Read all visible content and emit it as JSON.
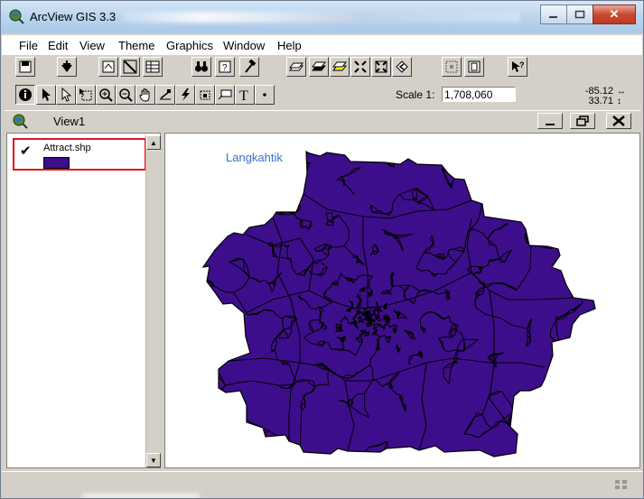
{
  "window": {
    "title": "ArcView GIS 3.3",
    "colors": {
      "titlebar": "#bcd6ef",
      "close": "#c74a33",
      "face": "#d4d0c8"
    }
  },
  "menu": {
    "items": [
      "File",
      "Edit",
      "View",
      "Theme",
      "Graphics",
      "Window",
      "Help"
    ]
  },
  "toolbar1": {
    "buttons": [
      "save-icon",
      "add-theme-icon",
      "theme-properties-icon",
      "edit-legend-icon",
      "open-table-icon",
      "find-icon",
      "query-icon",
      "locate-icon",
      "zoom-full-icon",
      "zoom-active-icon",
      "zoom-selected-icon",
      "zoom-in-fixed-icon",
      "zoom-out-fixed-icon",
      "zoom-previous-icon",
      "select-graphics-icon",
      "clear-selection-icon",
      "help-icon"
    ]
  },
  "toolbar2": {
    "buttons": [
      "identify-icon",
      "pointer-icon",
      "vertex-edit-icon",
      "select-feature-icon",
      "zoom-in-icon",
      "zoom-out-icon",
      "pan-icon",
      "measure-icon",
      "hotlink-icon",
      "area-of-interest-icon",
      "label-icon",
      "text-icon",
      "draw-point-icon"
    ]
  },
  "scale": {
    "label": "Scale 1:",
    "value": "1,708,060"
  },
  "coords": {
    "x": "-85.12",
    "y": "33.71",
    "arrows": "↔\n↕"
  },
  "view": {
    "title": "View1"
  },
  "toc": {
    "themes": [
      {
        "name": "Attract.shp",
        "checked": true,
        "color": "#3d0e8c"
      }
    ],
    "highlight_color": "#e0171e"
  },
  "map": {
    "label": "Langkahtik",
    "fill_color": "#3d0e8c",
    "stroke_color": "#000000"
  }
}
